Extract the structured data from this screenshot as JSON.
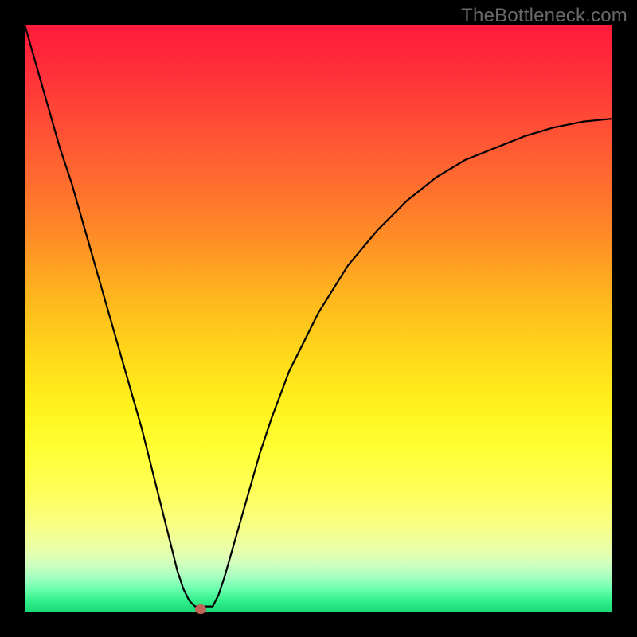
{
  "watermark": "TheBottleneck.com",
  "chart_data": {
    "type": "line",
    "title": "",
    "xlabel": "",
    "ylabel": "",
    "xlim": [
      0,
      100
    ],
    "ylim": [
      0,
      100
    ],
    "series": [
      {
        "name": "bottleneck-curve",
        "x": [
          0,
          2,
          4,
          6,
          8,
          10,
          12,
          14,
          16,
          18,
          20,
          22,
          24,
          26,
          27,
          28,
          29,
          30,
          31,
          32,
          33,
          34,
          36,
          38,
          40,
          42,
          45,
          50,
          55,
          60,
          65,
          70,
          75,
          80,
          85,
          90,
          95,
          100
        ],
        "y": [
          100,
          93,
          86,
          79,
          73,
          66,
          59,
          52,
          45,
          38,
          31,
          23,
          15,
          7,
          4,
          2,
          1,
          1,
          1,
          1,
          3,
          6,
          13,
          20,
          27,
          33,
          41,
          51,
          59,
          65,
          70,
          74,
          77,
          79,
          81,
          82.5,
          83.5,
          84
        ]
      }
    ],
    "marker": {
      "x": 30,
      "y": 0.5,
      "color": "#c16357"
    },
    "gradient_stops": [
      {
        "pos": 0,
        "color": "#ff1a3b"
      },
      {
        "pos": 50,
        "color": "#ffd81a"
      },
      {
        "pos": 72,
        "color": "#ffff5e"
      },
      {
        "pos": 100,
        "color": "#17d876"
      }
    ]
  }
}
